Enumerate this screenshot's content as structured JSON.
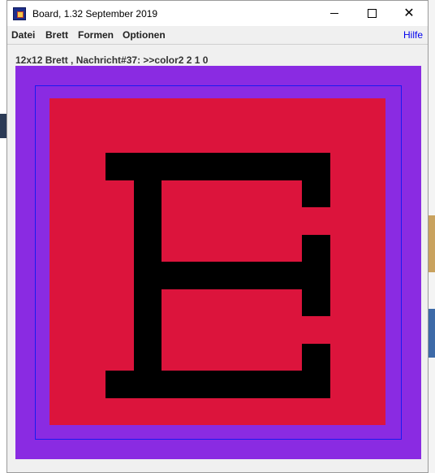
{
  "window": {
    "title": "Board, 1.32   September 2019"
  },
  "menu": {
    "items": [
      "Datei",
      "Brett",
      "Formen",
      "Optionen"
    ],
    "help": "Hilfe"
  },
  "status": {
    "message": "12x12 Brett , Nachricht#37: >>color2 2 1 0"
  },
  "colors": {
    "board_background": "#8a2be2",
    "frame_line": "#1a1af0",
    "cell_fill": "#dc143c",
    "glyph": "#000000"
  },
  "board": {
    "grid_size": 12,
    "glyph_depicted": "E"
  }
}
